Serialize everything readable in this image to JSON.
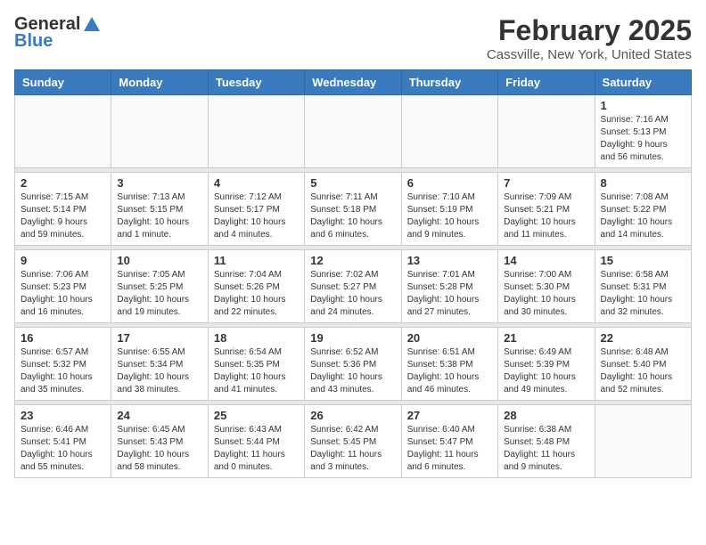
{
  "app": {
    "name_general": "General",
    "name_blue": "Blue"
  },
  "header": {
    "month": "February 2025",
    "location": "Cassville, New York, United States"
  },
  "days_of_week": [
    "Sunday",
    "Monday",
    "Tuesday",
    "Wednesday",
    "Thursday",
    "Friday",
    "Saturday"
  ],
  "weeks": [
    {
      "days": [
        {
          "date": "",
          "info": ""
        },
        {
          "date": "",
          "info": ""
        },
        {
          "date": "",
          "info": ""
        },
        {
          "date": "",
          "info": ""
        },
        {
          "date": "",
          "info": ""
        },
        {
          "date": "",
          "info": ""
        },
        {
          "date": "1",
          "info": "Sunrise: 7:16 AM\nSunset: 5:13 PM\nDaylight: 9 hours\nand 56 minutes."
        }
      ]
    },
    {
      "days": [
        {
          "date": "2",
          "info": "Sunrise: 7:15 AM\nSunset: 5:14 PM\nDaylight: 9 hours\nand 59 minutes."
        },
        {
          "date": "3",
          "info": "Sunrise: 7:13 AM\nSunset: 5:15 PM\nDaylight: 10 hours\nand 1 minute."
        },
        {
          "date": "4",
          "info": "Sunrise: 7:12 AM\nSunset: 5:17 PM\nDaylight: 10 hours\nand 4 minutes."
        },
        {
          "date": "5",
          "info": "Sunrise: 7:11 AM\nSunset: 5:18 PM\nDaylight: 10 hours\nand 6 minutes."
        },
        {
          "date": "6",
          "info": "Sunrise: 7:10 AM\nSunset: 5:19 PM\nDaylight: 10 hours\nand 9 minutes."
        },
        {
          "date": "7",
          "info": "Sunrise: 7:09 AM\nSunset: 5:21 PM\nDaylight: 10 hours\nand 11 minutes."
        },
        {
          "date": "8",
          "info": "Sunrise: 7:08 AM\nSunset: 5:22 PM\nDaylight: 10 hours\nand 14 minutes."
        }
      ]
    },
    {
      "days": [
        {
          "date": "9",
          "info": "Sunrise: 7:06 AM\nSunset: 5:23 PM\nDaylight: 10 hours\nand 16 minutes."
        },
        {
          "date": "10",
          "info": "Sunrise: 7:05 AM\nSunset: 5:25 PM\nDaylight: 10 hours\nand 19 minutes."
        },
        {
          "date": "11",
          "info": "Sunrise: 7:04 AM\nSunset: 5:26 PM\nDaylight: 10 hours\nand 22 minutes."
        },
        {
          "date": "12",
          "info": "Sunrise: 7:02 AM\nSunset: 5:27 PM\nDaylight: 10 hours\nand 24 minutes."
        },
        {
          "date": "13",
          "info": "Sunrise: 7:01 AM\nSunset: 5:28 PM\nDaylight: 10 hours\nand 27 minutes."
        },
        {
          "date": "14",
          "info": "Sunrise: 7:00 AM\nSunset: 5:30 PM\nDaylight: 10 hours\nand 30 minutes."
        },
        {
          "date": "15",
          "info": "Sunrise: 6:58 AM\nSunset: 5:31 PM\nDaylight: 10 hours\nand 32 minutes."
        }
      ]
    },
    {
      "days": [
        {
          "date": "16",
          "info": "Sunrise: 6:57 AM\nSunset: 5:32 PM\nDaylight: 10 hours\nand 35 minutes."
        },
        {
          "date": "17",
          "info": "Sunrise: 6:55 AM\nSunset: 5:34 PM\nDaylight: 10 hours\nand 38 minutes."
        },
        {
          "date": "18",
          "info": "Sunrise: 6:54 AM\nSunset: 5:35 PM\nDaylight: 10 hours\nand 41 minutes."
        },
        {
          "date": "19",
          "info": "Sunrise: 6:52 AM\nSunset: 5:36 PM\nDaylight: 10 hours\nand 43 minutes."
        },
        {
          "date": "20",
          "info": "Sunrise: 6:51 AM\nSunset: 5:38 PM\nDaylight: 10 hours\nand 46 minutes."
        },
        {
          "date": "21",
          "info": "Sunrise: 6:49 AM\nSunset: 5:39 PM\nDaylight: 10 hours\nand 49 minutes."
        },
        {
          "date": "22",
          "info": "Sunrise: 6:48 AM\nSunset: 5:40 PM\nDaylight: 10 hours\nand 52 minutes."
        }
      ]
    },
    {
      "days": [
        {
          "date": "23",
          "info": "Sunrise: 6:46 AM\nSunset: 5:41 PM\nDaylight: 10 hours\nand 55 minutes."
        },
        {
          "date": "24",
          "info": "Sunrise: 6:45 AM\nSunset: 5:43 PM\nDaylight: 10 hours\nand 58 minutes."
        },
        {
          "date": "25",
          "info": "Sunrise: 6:43 AM\nSunset: 5:44 PM\nDaylight: 11 hours\nand 0 minutes."
        },
        {
          "date": "26",
          "info": "Sunrise: 6:42 AM\nSunset: 5:45 PM\nDaylight: 11 hours\nand 3 minutes."
        },
        {
          "date": "27",
          "info": "Sunrise: 6:40 AM\nSunset: 5:47 PM\nDaylight: 11 hours\nand 6 minutes."
        },
        {
          "date": "28",
          "info": "Sunrise: 6:38 AM\nSunset: 5:48 PM\nDaylight: 11 hours\nand 9 minutes."
        },
        {
          "date": "",
          "info": ""
        }
      ]
    }
  ]
}
